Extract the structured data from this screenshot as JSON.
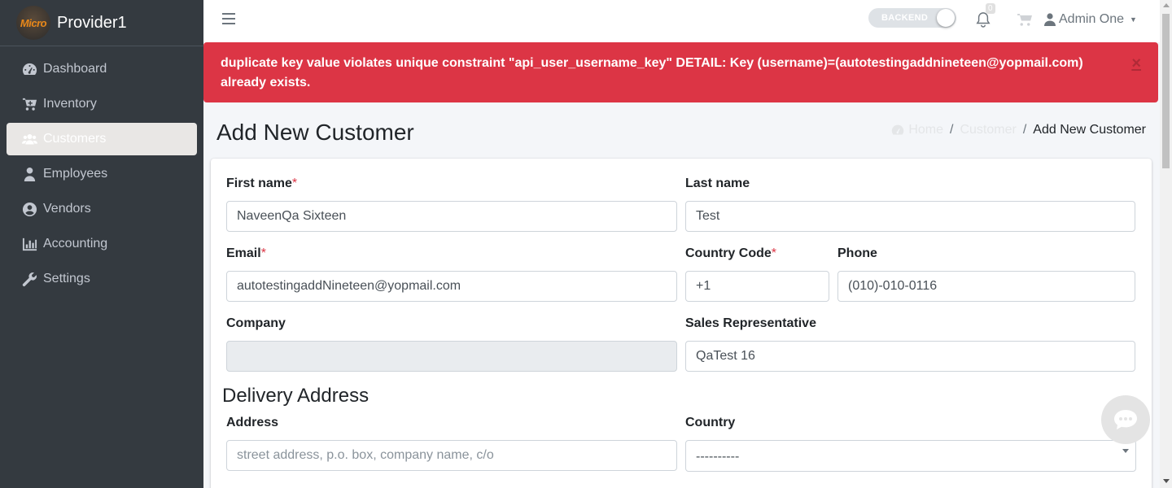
{
  "brand": {
    "name": "Provider1",
    "logo_text": "Micro"
  },
  "sidebar": {
    "items": [
      {
        "label": "Dashboard",
        "icon": "dashboard-icon"
      },
      {
        "label": "Inventory",
        "icon": "cart-plus-icon"
      },
      {
        "label": "Customers",
        "icon": "users-icon",
        "active": true
      },
      {
        "label": "Employees",
        "icon": "user-tie-icon"
      },
      {
        "label": "Vendors",
        "icon": "user-circle-icon"
      },
      {
        "label": "Accounting",
        "icon": "chart-bar-icon"
      },
      {
        "label": "Settings",
        "icon": "wrench-icon"
      }
    ]
  },
  "topbar": {
    "toggle_label": "BACKEND",
    "notification_count": "0",
    "user_name": "Admin One"
  },
  "alert": {
    "message": "duplicate key value violates unique constraint \"api_user_username_key\" DETAIL: Key (username)=(autotestingaddnineteen@yopmail.com) already exists.",
    "close": "×",
    "color": "#dc3545"
  },
  "page": {
    "title": "Add New Customer",
    "breadcrumb": {
      "home": "Home",
      "section": "Customer",
      "current": "Add New Customer"
    }
  },
  "form": {
    "first_name": {
      "label": "First name",
      "required": "*",
      "value": "NaveenQa Sixteen"
    },
    "last_name": {
      "label": "Last name",
      "value": "Test"
    },
    "email": {
      "label": "Email",
      "required": "*",
      "value": "autotestingaddNineteen@yopmail.com"
    },
    "country_code": {
      "label": "Country Code",
      "required": "*",
      "value": "+1"
    },
    "phone": {
      "label": "Phone",
      "value": "(010)-010-0116"
    },
    "company": {
      "label": "Company",
      "value": ""
    },
    "sales_rep": {
      "label": "Sales Representative",
      "value": "QaTest 16"
    },
    "delivery_title": "Delivery Address",
    "address": {
      "label": "Address",
      "placeholder": "street address, p.o. box, company name, c/o"
    },
    "country": {
      "label": "Country",
      "value": "----------"
    }
  }
}
